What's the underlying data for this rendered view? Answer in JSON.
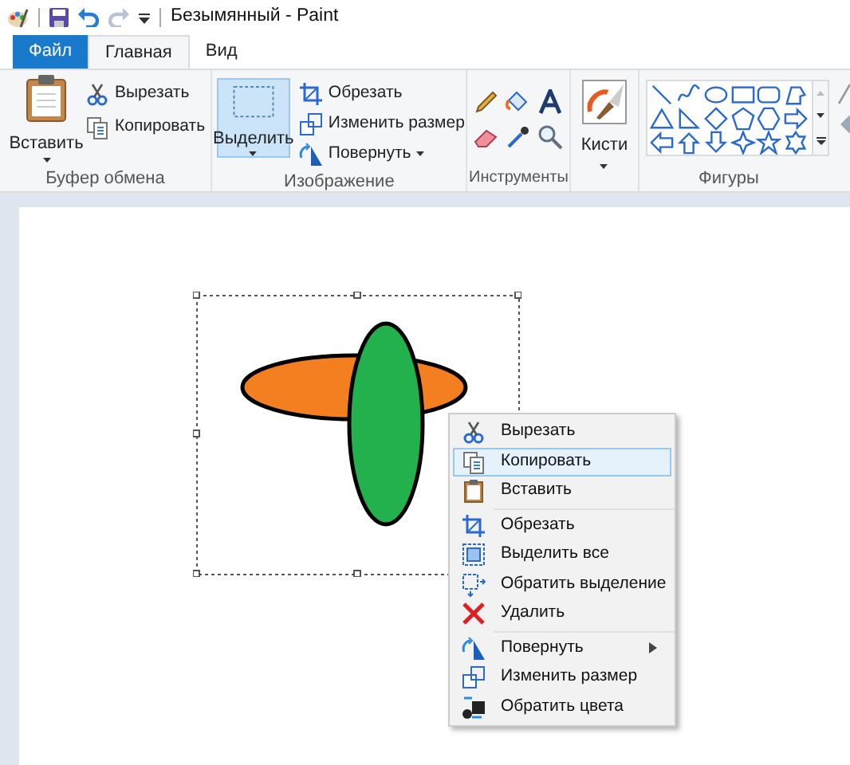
{
  "window": {
    "title": "Безымянный - Paint"
  },
  "tabs": [
    {
      "label": "Файл",
      "kind": "file",
      "selected": false
    },
    {
      "label": "Главная",
      "kind": "tab",
      "selected": true
    },
    {
      "label": "Вид",
      "kind": "tab",
      "selected": false
    }
  ],
  "ribbon": {
    "clipboard": {
      "label": "Буфер обмена",
      "paste": "Вставить",
      "cut": "Вырезать",
      "copy": "Копировать"
    },
    "image": {
      "label": "Изображение",
      "select": "Выделить",
      "select_selected": true,
      "crop": "Обрезать",
      "resize": "Изменить размер",
      "rotate": "Повернуть"
    },
    "tools": {
      "label": "Инструменты"
    },
    "brushes": {
      "label": "Кисти"
    },
    "shapes": {
      "label": "Фигуры"
    }
  },
  "context_menu": [
    {
      "label": "Вырезать",
      "kind": "item",
      "selected": false,
      "separator_before": false
    },
    {
      "label": "Копировать",
      "kind": "item",
      "selected": true,
      "separator_before": false
    },
    {
      "label": "Вставить",
      "kind": "item",
      "selected": false,
      "separator_before": false
    },
    {
      "label": "Обрезать",
      "kind": "item",
      "selected": false,
      "separator_before": true
    },
    {
      "label": "Выделить все",
      "kind": "item",
      "selected": false,
      "separator_before": false
    },
    {
      "label": "Обратить выделение",
      "kind": "item",
      "selected": false,
      "separator_before": false
    },
    {
      "label": "Удалить",
      "kind": "item",
      "selected": false,
      "separator_before": false
    },
    {
      "label": "Повернуть",
      "kind": "submenu",
      "selected": false,
      "separator_before": true
    },
    {
      "label": "Изменить размер",
      "kind": "item",
      "selected": false,
      "separator_before": false
    },
    {
      "label": "Обратить цвета",
      "kind": "item",
      "selected": false,
      "separator_before": false
    }
  ]
}
